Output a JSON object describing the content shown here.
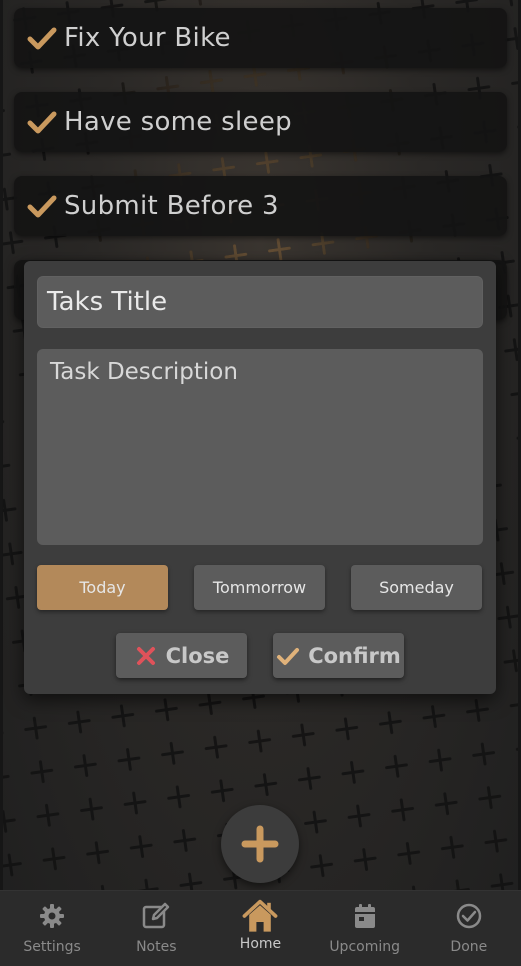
{
  "tasks": [
    {
      "label": "Fix Your Bike",
      "icon": "check-icon"
    },
    {
      "label": "Have some sleep",
      "icon": "check-icon"
    },
    {
      "label": "Submit Before 3",
      "icon": "check-icon"
    }
  ],
  "modal": {
    "title_value": "Taks Title",
    "description_value": "Task Description",
    "when_options": [
      "Today",
      "Tommorrow",
      "Someday"
    ],
    "selected_when": "Today",
    "close_label": "Close",
    "confirm_label": "Confirm"
  },
  "fab": {
    "icon": "plus-icon"
  },
  "tabbar": {
    "items": [
      {
        "label": "Settings",
        "icon": "gear-icon"
      },
      {
        "label": "Notes",
        "icon": "edit-icon"
      },
      {
        "label": "Home",
        "icon": "home-icon"
      },
      {
        "label": "Upcoming",
        "icon": "calendar-icon"
      },
      {
        "label": "Done",
        "icon": "check-circle-icon"
      }
    ],
    "active": "Home"
  },
  "colors": {
    "accent": "#b3895a",
    "surface": "#3d3d3d",
    "input": "#5c5c5c",
    "close_x": "#e0525a"
  }
}
